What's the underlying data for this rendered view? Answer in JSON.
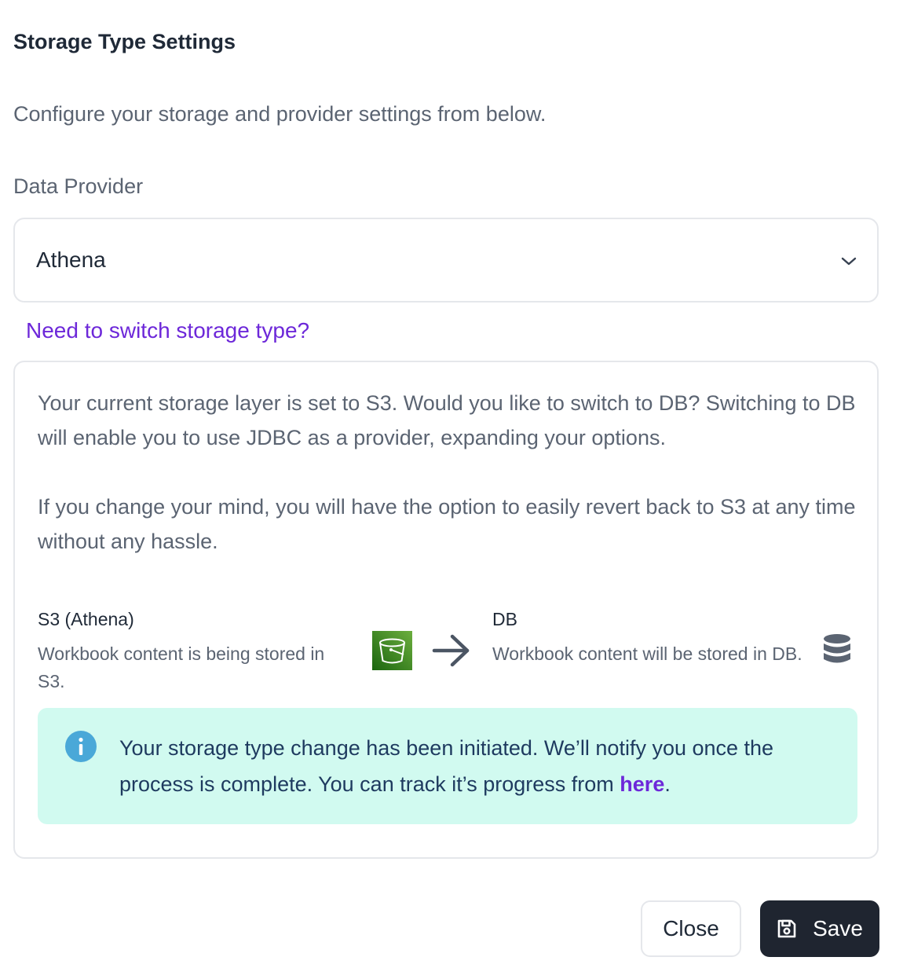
{
  "dialog": {
    "title": "Storage Type Settings",
    "subtitle": "Configure your storage and provider settings from below."
  },
  "data_provider": {
    "label": "Data Provider",
    "selected": "Athena"
  },
  "switch_link": "Need to switch storage type?",
  "panel": {
    "paragraph1": "Your current storage layer is set to S3. Would you like to switch to DB? Switching to DB will enable you to use JDBC as a provider, expanding your options.",
    "paragraph2": "If you change your mind, you will have the option to easily revert back to S3 at any time without any hassle.",
    "from": {
      "name": "S3 (Athena)",
      "description": "Workbook content is being stored in S3.",
      "icon": "s3-bucket-icon"
    },
    "to": {
      "name": "DB",
      "description": "Workbook content will be stored in DB.",
      "icon": "database-icon"
    },
    "notice": {
      "text": "Your storage type change has been initiated. We’ll notify you once the process is complete. You can track it’s progress from ",
      "link": "here",
      "suffix": ".",
      "icon": "info-icon"
    }
  },
  "buttons": {
    "close": "Close",
    "save": "Save"
  },
  "colors": {
    "accent": "#6d28d9",
    "notice_bg": "#d1faf0",
    "info": "#4aa8d8",
    "primary_button": "#1f2530",
    "s3_green": "#3f8624"
  }
}
